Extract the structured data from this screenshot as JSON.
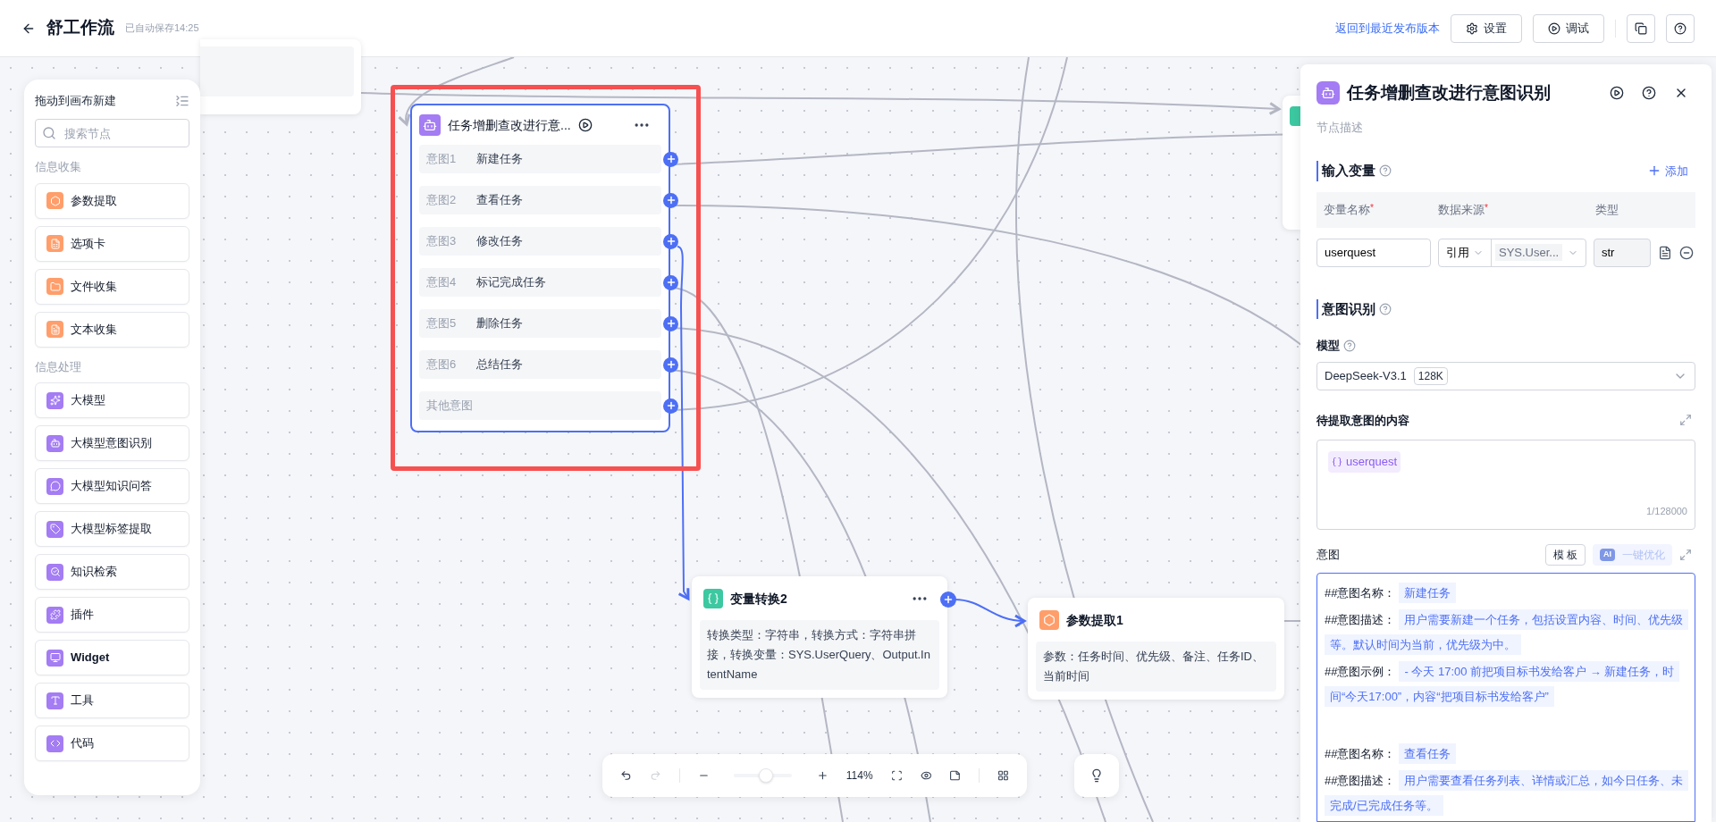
{
  "header": {
    "title": "舒工作流",
    "autosave": "已自动保存14:25",
    "revert_link": "返回到最近发布版本",
    "buttons": [
      {
        "label": "设置"
      },
      {
        "label": "调试"
      }
    ]
  },
  "sidebar": {
    "title": "拖动到画布新建",
    "search": {
      "placeholder": "搜索节点"
    },
    "sections": [
      {
        "title": "信息收集",
        "items": [
          {
            "label": "参数提取",
            "color": "#ff9e6b"
          },
          {
            "label": "选项卡",
            "color": "#ff9e6b"
          },
          {
            "label": "文件收集",
            "color": "#ff9e6b"
          },
          {
            "label": "文本收集",
            "color": "#ff9e6b"
          }
        ]
      },
      {
        "title": "信息处理",
        "items": [
          {
            "label": "大模型",
            "color": "#a47cf3"
          },
          {
            "label": "大模型意图识别",
            "color": "#a47cf3"
          },
          {
            "label": "大模型知识问答",
            "color": "#a47cf3"
          },
          {
            "label": "大模型标签提取",
            "color": "#a47cf3"
          },
          {
            "label": "知识检索",
            "color": "#a47cf3"
          },
          {
            "label": "插件",
            "color": "#a47cf3"
          },
          {
            "label": "Widget",
            "color": "#a47cf3"
          },
          {
            "label": "工具",
            "color": "#a47cf3"
          },
          {
            "label": "代码",
            "color": "#a47cf3"
          }
        ]
      }
    ]
  },
  "intent_node": {
    "title": "任务增删查改进行意...",
    "selected": true,
    "highlighted": true,
    "intents": [
      {
        "label": "意图1",
        "name": "新建任务"
      },
      {
        "label": "意图2",
        "name": "查看任务"
      },
      {
        "label": "意图3",
        "name": "修改任务"
      },
      {
        "label": "意图4",
        "name": "标记完成任务"
      },
      {
        "label": "意图5",
        "name": "删除任务"
      },
      {
        "label": "意图6",
        "name": "总结任务"
      },
      {
        "label": "其他意图"
      }
    ]
  },
  "transform_node": {
    "title": "变量转换2",
    "selected": false,
    "summary": "转换类型：字符串，转换方式：字符串拼接，转换变量：SYS.UserQuery、Output.IntentName"
  },
  "param_node": {
    "title": "参数提取1",
    "selected": false,
    "summary": "参数：任务时间、优先级、备注、任务ID、当前时间"
  },
  "toolbar": {
    "history": [
      {
        "kind": "undo",
        "disabled": false
      },
      {
        "kind": "redo",
        "disabled": true
      }
    ],
    "zoom": {
      "level": 0.55,
      "reading": "114%"
    }
  },
  "panel": {
    "title": "任务增删查改进行意图识别",
    "description": {
      "placeholder": "节点描述"
    },
    "inputs": {
      "title": "输入变量",
      "add": "添加",
      "required_mark": "*",
      "columns": [
        {
          "label": "变量名称",
          "required": true
        },
        {
          "label": "数据来源",
          "required": true
        },
        {
          "label": "类型",
          "required": false
        }
      ],
      "rows": [
        {
          "name": "userquest",
          "source_mode": "引用",
          "source": "SYS.User...",
          "type": "str"
        }
      ]
    },
    "recognition": {
      "title": "意图识别",
      "model_label": "模型",
      "model": "DeepSeek-V3.1",
      "context": "128K",
      "content_label": "待提取意图的内容",
      "content_tag": "userquest",
      "counter": "1/128000",
      "intents_label": "意图",
      "template_button": "模 板",
      "optimize": {
        "badge": "AI",
        "label": "一键优化",
        "disabled": true
      },
      "prompt": [
        [
          {
            "label": "##意图名称：",
            "value": "新建任务"
          },
          {
            "label": "##意图描述：",
            "value": "用户需要新建一个任务，包括设置内容、时间、优先级等。默认时间为当前，优先级为中。"
          },
          {
            "label": "##意图示例：",
            "value": "- 今天 17:00 前把项目标书发给客户 → 新建任务，时间“今天17:00”，内容“把项目标书发给客户”"
          }
        ],
        [
          {
            "label": "##意图名称：",
            "value": "查看任务"
          },
          {
            "label": "##意图描述：",
            "value": "用户需要查看任务列表、详情或汇总，如今日任务、未完成/已完成任务等。"
          }
        ]
      ]
    }
  }
}
